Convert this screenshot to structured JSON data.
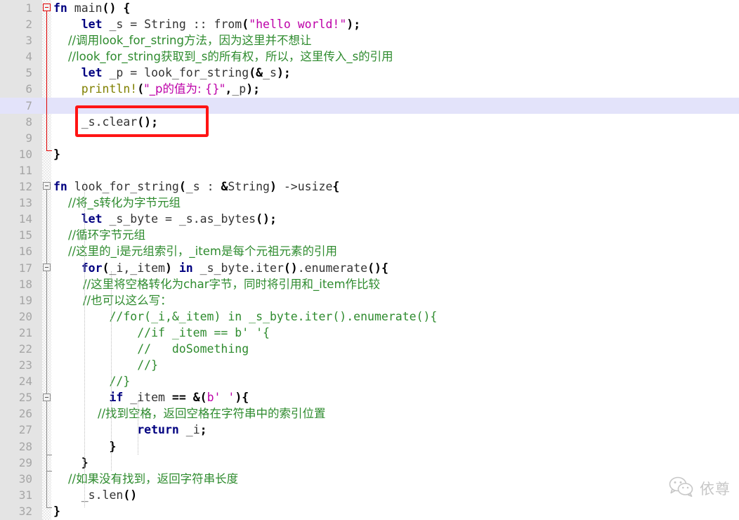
{
  "editor": {
    "language": "rust",
    "colors": {
      "gutter_bg": "#e4e4e4",
      "line_number": "#a6a6a6",
      "keyword": "#000080",
      "string": "#bd00a8",
      "comment": "#2e8b2e",
      "macro": "#808000",
      "identifier": "#333333",
      "current_line_highlight": "#e3e3fa",
      "annotation_red": "#ff1414",
      "fold_line": "#8a8a8a",
      "fold_line_active": "#e00000"
    },
    "highlighted_line": 7,
    "annotation": {
      "type": "red-rectangle",
      "target_line": 8,
      "target_text": "_s.clear();"
    },
    "fold_markers": [
      {
        "line": 1,
        "state": "expanded",
        "active": true
      },
      {
        "line": 12,
        "state": "expanded",
        "active": false
      },
      {
        "line": 17,
        "state": "expanded",
        "active": false
      },
      {
        "line": 25,
        "state": "expanded",
        "active": false
      }
    ],
    "lines": [
      {
        "n": "1",
        "tokens": [
          {
            "t": "fn",
            "c": "kw"
          },
          {
            "t": " main",
            "c": "id"
          },
          {
            "t": "()",
            "c": "pun"
          },
          {
            "t": " ",
            "c": "id"
          },
          {
            "t": "{",
            "c": "pun"
          }
        ]
      },
      {
        "n": "2",
        "tokens": [
          {
            "t": "    ",
            "c": "id"
          },
          {
            "t": "let",
            "c": "kw"
          },
          {
            "t": " _s = String :: from",
            "c": "id"
          },
          {
            "t": "(",
            "c": "pun"
          },
          {
            "t": "\"hello world!\"",
            "c": "str"
          },
          {
            "t": ")",
            "c": "pun"
          },
          {
            "t": ";",
            "c": "pun"
          }
        ]
      },
      {
        "n": "3",
        "tokens": [
          {
            "t": "    //调用look_for_string方法，因为这里并不想让",
            "c": "cm"
          }
        ]
      },
      {
        "n": "4",
        "tokens": [
          {
            "t": "    //look_for_string获取到_s的所有权，所以，这里传入_s的引用",
            "c": "cm"
          }
        ]
      },
      {
        "n": "5",
        "tokens": [
          {
            "t": "    ",
            "c": "id"
          },
          {
            "t": "let",
            "c": "kw"
          },
          {
            "t": " _p = look_for_string",
            "c": "id"
          },
          {
            "t": "(&",
            "c": "pun"
          },
          {
            "t": "_s",
            "c": "id"
          },
          {
            "t": ")",
            "c": "pun"
          },
          {
            "t": ";",
            "c": "pun"
          }
        ]
      },
      {
        "n": "6",
        "tokens": [
          {
            "t": "    ",
            "c": "id"
          },
          {
            "t": "println!",
            "c": "mac"
          },
          {
            "t": "(",
            "c": "pun"
          },
          {
            "t": "\"_p的值为: {}\"",
            "c": "str"
          },
          {
            "t": ",",
            "c": "pun"
          },
          {
            "t": "_p",
            "c": "id"
          },
          {
            "t": ")",
            "c": "pun"
          },
          {
            "t": ";",
            "c": "pun"
          }
        ]
      },
      {
        "n": "7",
        "tokens": []
      },
      {
        "n": "8",
        "tokens": [
          {
            "t": "    _s.clear",
            "c": "id"
          },
          {
            "t": "()",
            "c": "pun"
          },
          {
            "t": ";",
            "c": "pun"
          }
        ]
      },
      {
        "n": "9",
        "tokens": []
      },
      {
        "n": "10",
        "tokens": [
          {
            "t": "}",
            "c": "pun"
          }
        ]
      },
      {
        "n": "11",
        "tokens": []
      },
      {
        "n": "12",
        "tokens": [
          {
            "t": "fn",
            "c": "kw"
          },
          {
            "t": " look_for_string",
            "c": "id"
          },
          {
            "t": "(",
            "c": "pun"
          },
          {
            "t": "_s : ",
            "c": "id"
          },
          {
            "t": "&",
            "c": "pun"
          },
          {
            "t": "String",
            "c": "id"
          },
          {
            "t": ")",
            "c": "pun"
          },
          {
            "t": " ->usize",
            "c": "id"
          },
          {
            "t": "{",
            "c": "pun"
          }
        ]
      },
      {
        "n": "13",
        "tokens": [
          {
            "t": "    //将_s转化为字节元组",
            "c": "cm"
          }
        ]
      },
      {
        "n": "14",
        "tokens": [
          {
            "t": "    ",
            "c": "id"
          },
          {
            "t": "let",
            "c": "kw"
          },
          {
            "t": " _s_byte = _s.as_bytes",
            "c": "id"
          },
          {
            "t": "()",
            "c": "pun"
          },
          {
            "t": ";",
            "c": "pun"
          }
        ]
      },
      {
        "n": "15",
        "tokens": [
          {
            "t": "    //循环字节元组",
            "c": "cm"
          }
        ]
      },
      {
        "n": "16",
        "tokens": [
          {
            "t": "    //这里的_i是元组索引，_item是每个元祖元素的引用",
            "c": "cm"
          }
        ]
      },
      {
        "n": "17",
        "tokens": [
          {
            "t": "    ",
            "c": "id"
          },
          {
            "t": "for",
            "c": "kw"
          },
          {
            "t": "(",
            "c": "pun"
          },
          {
            "t": "_i,_item",
            "c": "id"
          },
          {
            "t": ")",
            "c": "pun"
          },
          {
            "t": " ",
            "c": "id"
          },
          {
            "t": "in",
            "c": "kw"
          },
          {
            "t": " _s_byte.iter",
            "c": "id"
          },
          {
            "t": "()",
            "c": "pun"
          },
          {
            "t": ".enumerate",
            "c": "id"
          },
          {
            "t": "()",
            "c": "pun"
          },
          {
            "t": "{",
            "c": "pun"
          }
        ]
      },
      {
        "n": "18",
        "tokens": [
          {
            "t": "        //这里将空格转化为char字节，同时将引用和_item作比较",
            "c": "cm"
          }
        ]
      },
      {
        "n": "19",
        "tokens": [
          {
            "t": "        //也可以这么写：",
            "c": "cm"
          }
        ]
      },
      {
        "n": "20",
        "tokens": [
          {
            "t": "        //for(_i,&_item) in _s_byte.iter().enumerate(){",
            "c": "cm"
          }
        ]
      },
      {
        "n": "21",
        "tokens": [
          {
            "t": "            //if _item == b' '{",
            "c": "cm"
          }
        ]
      },
      {
        "n": "22",
        "tokens": [
          {
            "t": "            //   doSomething",
            "c": "cm"
          }
        ]
      },
      {
        "n": "23",
        "tokens": [
          {
            "t": "            //}",
            "c": "cm"
          }
        ]
      },
      {
        "n": "24",
        "tokens": [
          {
            "t": "        //}",
            "c": "cm"
          }
        ]
      },
      {
        "n": "25",
        "tokens": [
          {
            "t": "        ",
            "c": "id"
          },
          {
            "t": "if",
            "c": "kw"
          },
          {
            "t": " _item ",
            "c": "id"
          },
          {
            "t": "==",
            "c": "pun"
          },
          {
            "t": " ",
            "c": "id"
          },
          {
            "t": "&(",
            "c": "pun"
          },
          {
            "t": "b",
            "c": "str"
          },
          {
            "t": "' '",
            "c": "str"
          },
          {
            "t": ")",
            "c": "pun"
          },
          {
            "t": "{",
            "c": "pun"
          }
        ]
      },
      {
        "n": "26",
        "tokens": [
          {
            "t": "            //找到空格，返回空格在字符串中的索引位置",
            "c": "cm"
          }
        ]
      },
      {
        "n": "27",
        "tokens": [
          {
            "t": "            ",
            "c": "id"
          },
          {
            "t": "return",
            "c": "kw"
          },
          {
            "t": " _i",
            "c": "id"
          },
          {
            "t": ";",
            "c": "pun"
          }
        ]
      },
      {
        "n": "28",
        "tokens": [
          {
            "t": "        }",
            "c": "pun"
          }
        ]
      },
      {
        "n": "29",
        "tokens": [
          {
            "t": "    }",
            "c": "pun"
          }
        ]
      },
      {
        "n": "30",
        "tokens": [
          {
            "t": "    //如果没有找到，返回字符串长度",
            "c": "cm"
          }
        ]
      },
      {
        "n": "31",
        "tokens": [
          {
            "t": "    _s.len",
            "c": "id"
          },
          {
            "t": "()",
            "c": "pun"
          }
        ]
      },
      {
        "n": "32",
        "tokens": [
          {
            "t": "}",
            "c": "pun"
          }
        ]
      }
    ]
  },
  "watermark": {
    "icon": "wechat-icon",
    "text": "依尊"
  }
}
